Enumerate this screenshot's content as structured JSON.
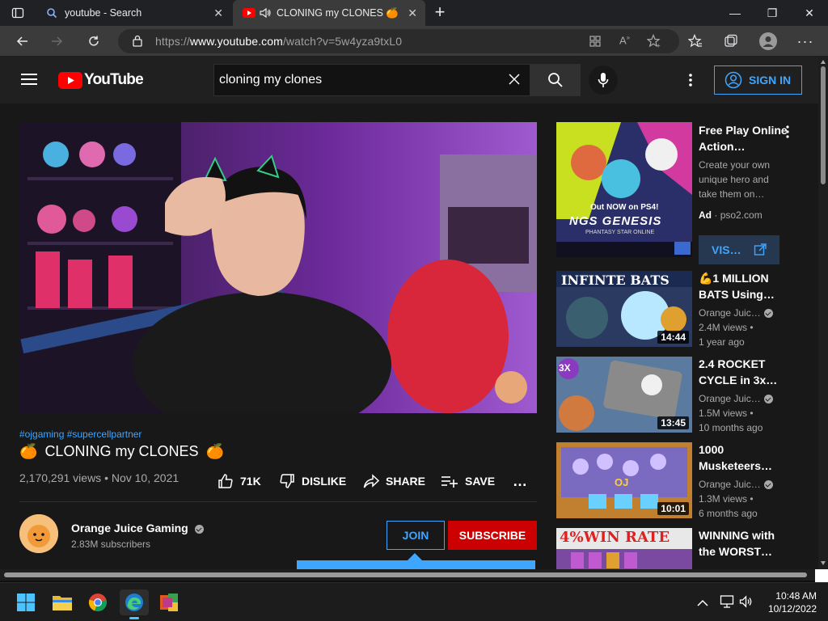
{
  "browser": {
    "tabs": [
      {
        "title": "youtube - Search",
        "active": false
      },
      {
        "title": "CLONING my CLONES 🍊",
        "active": true
      }
    ],
    "url_prefix": "https://",
    "url_domain": "www.youtube.com",
    "url_path": "/watch?v=5w4yza9txL0",
    "new_tab_symbol": "+",
    "window_controls": {
      "minimize": "—",
      "restore": "❐",
      "close": "✕"
    }
  },
  "header": {
    "logo_text": "YouTube",
    "search_value": "cloning my clones",
    "signin_label": "SIGN IN"
  },
  "video": {
    "hashtags": "#ojgaming #supercellpartner",
    "title": "CLONING my CLONES",
    "title_emoji": "🍊",
    "views_date": "2,170,291 views • Nov 10, 2021",
    "likes": "71K",
    "dislike_label": "DISLIKE",
    "share_label": "SHARE",
    "save_label": "SAVE",
    "more": "…"
  },
  "channel": {
    "name": "Orange Juice Gaming",
    "subscribers": "2.83M subscribers",
    "join_label": "JOIN",
    "subscribe_label": "SUBSCRIBE"
  },
  "sidebar": {
    "ad": {
      "title": "Free Play Online Action…",
      "description": "Create your own unique hero and take them on…",
      "badge": "Ad",
      "source": "pso2.com",
      "visit_label": "VIS…",
      "thumb_banner": "Out NOW on PS4!",
      "thumb_logo": "NGS GENESIS",
      "thumb_subtitle": "PHANTASY STAR ONLINE"
    },
    "items": [
      {
        "title": "💪1 MILLION BATS Using…",
        "channel": "Orange Juic…",
        "views": "2.4M views •",
        "age": "1 year ago",
        "duration": "14:44",
        "thumb_text": "INFINTE BATS"
      },
      {
        "title": "2.4 ROCKET CYCLE in 3x…",
        "channel": "Orange Juic…",
        "views": "1.5M views •",
        "age": "10 months ago",
        "duration": "13:45",
        "thumb_text": "3X"
      },
      {
        "title": "1000 Musketeers…",
        "channel": "Orange Juic…",
        "views": "1.3M views •",
        "age": "6 months ago",
        "duration": "10:01",
        "thumb_text": "OJ"
      },
      {
        "title": "WINNING with the WORST…",
        "channel": "",
        "views": "",
        "age": "",
        "duration": "",
        "thumb_text": "4%WIN RATE"
      }
    ]
  },
  "taskbar": {
    "time": "10:48 AM",
    "date": "10/12/2022"
  },
  "colors": {
    "accent_blue": "#3ea6ff",
    "subscribe_red": "#cc0000",
    "youtube_red": "#ff0000"
  }
}
